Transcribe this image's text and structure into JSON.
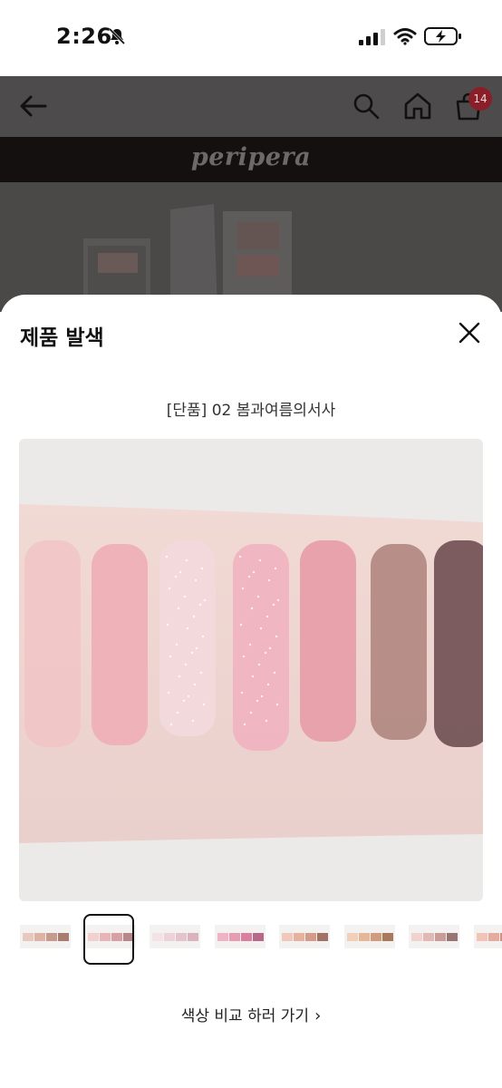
{
  "status_bar": {
    "time": "2:26",
    "icons": [
      "bell-slash-icon",
      "cellular-signal-icon",
      "wifi-icon",
      "battery-charging-icon"
    ]
  },
  "header": {
    "icons": [
      "back-arrow-icon",
      "search-icon",
      "home-icon",
      "shopping-bag-icon"
    ],
    "cart_count": "14",
    "badge_color": "#8a1f2a"
  },
  "brand": {
    "logo_text": "peripera"
  },
  "sheet": {
    "title": "제품 발색",
    "product_name": "[단품] 02 봄과여름의서사",
    "swatch_colors": [
      "#f1c2c4",
      "#f0aeb6",
      "#f3d9dd",
      "#f0b3c0",
      "#e79ca6",
      "#b08680",
      "#6f4f51"
    ],
    "thumbnails": {
      "count": 8,
      "selected_index": 1
    },
    "compare_link": "색상 비교 하러 가기"
  }
}
